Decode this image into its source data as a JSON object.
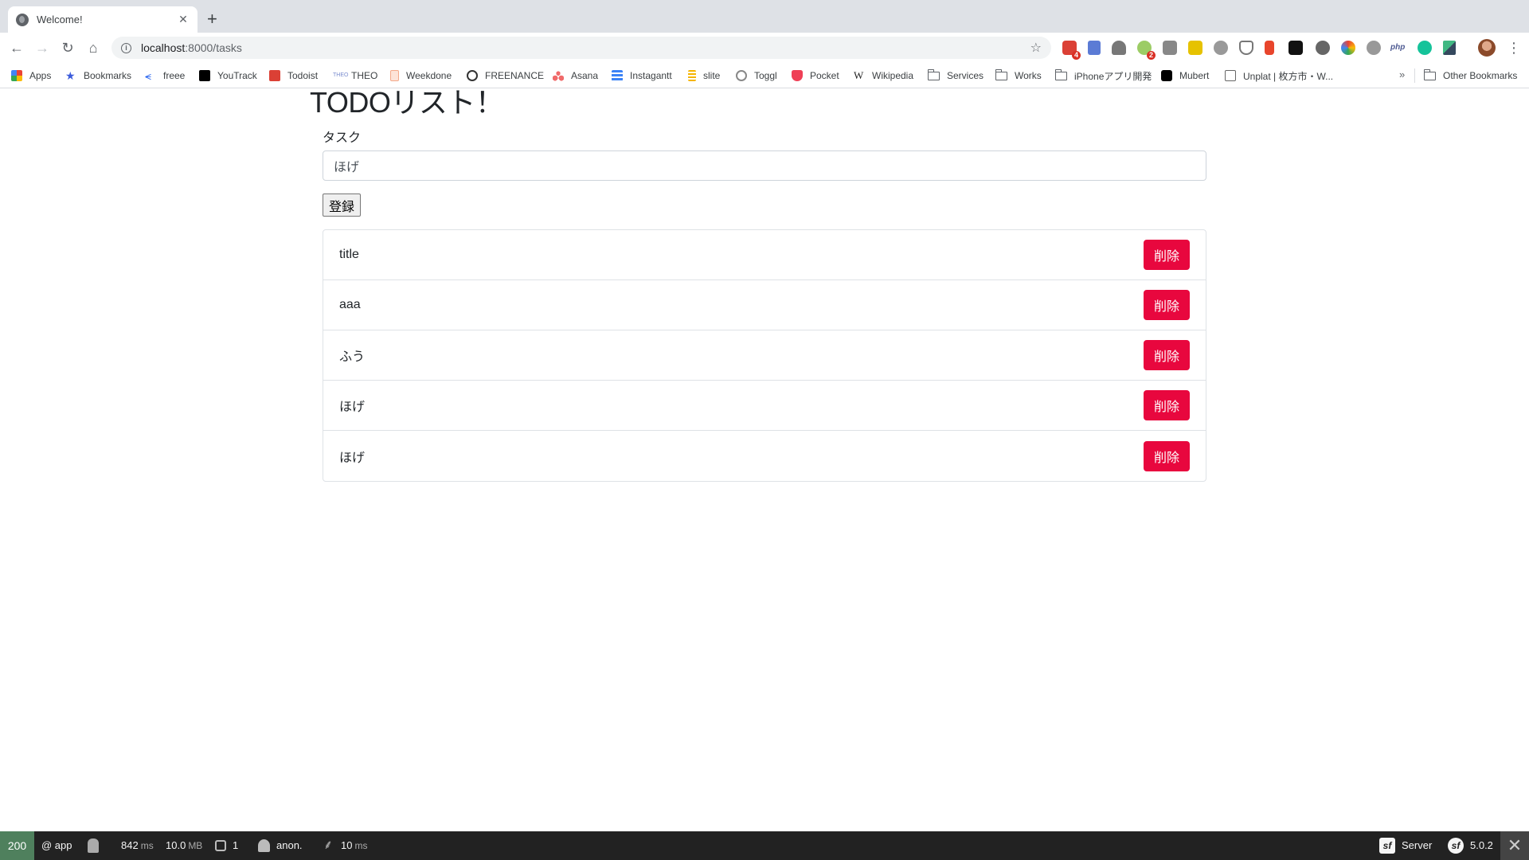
{
  "browser": {
    "tab_title": "Welcome!",
    "url_host": "localhost",
    "url_path": ":8000/tasks",
    "extension_badges": {
      "todoist": "4",
      "bulb": "2"
    }
  },
  "bookmarks": [
    {
      "label": "Apps",
      "icon": "apps-grid-icon",
      "color": "#4285f4"
    },
    {
      "label": "Bookmarks",
      "icon": "star-icon",
      "color": "#3b5bdb"
    },
    {
      "label": "freee",
      "icon": "freee-icon",
      "color": "#2864f0"
    },
    {
      "label": "YouTrack",
      "icon": "youtrack-icon",
      "color": "#000000"
    },
    {
      "label": "Todoist",
      "icon": "todoist-icon",
      "color": "#db4035"
    },
    {
      "label": "THEO",
      "icon": "theo-icon",
      "color": "#7a8ccf"
    },
    {
      "label": "Weekdone",
      "icon": "weekdone-icon",
      "color": "#f4a98a"
    },
    {
      "label": "FREENANCE",
      "icon": "freenance-icon",
      "color": "#333333"
    },
    {
      "label": "Asana",
      "icon": "asana-icon",
      "color": "#f06a6a"
    },
    {
      "label": "Instagantt",
      "icon": "instagantt-icon",
      "color": "#3b82f6"
    },
    {
      "label": "slite",
      "icon": "slite-icon",
      "color": "#f5b400"
    },
    {
      "label": "Toggl",
      "icon": "toggl-icon",
      "color": "#888888"
    },
    {
      "label": "Pocket",
      "icon": "pocket-icon",
      "color": "#ef3f56"
    },
    {
      "label": "Wikipedia",
      "icon": "wikipedia-icon",
      "color": "#222222"
    },
    {
      "label": "Services",
      "icon": "folder-icon",
      "color": "#5f6368"
    },
    {
      "label": "Works",
      "icon": "folder-icon",
      "color": "#5f6368"
    },
    {
      "label": "iPhoneアプリ開発",
      "icon": "folder-icon",
      "color": "#5f6368"
    },
    {
      "label": "Mubert",
      "icon": "mubert-icon",
      "color": "#000000"
    },
    {
      "label": "Unplat | 枚方市・W...",
      "icon": "unplat-icon",
      "color": "#666666"
    }
  ],
  "bookmarks_more": "»",
  "other_bookmarks": "Other Bookmarks",
  "page": {
    "title": "TODOリスト！",
    "task_label": "タスク",
    "task_input_value": "ほげ",
    "submit_label": "登録",
    "delete_label": "削除",
    "tasks": [
      "title",
      "aaa",
      "ふう",
      "ほげ",
      "ほげ"
    ]
  },
  "debugbar": {
    "status_code": "200",
    "route": "@ app",
    "time_value": "842",
    "time_unit": "ms",
    "memory_value": "10.0",
    "memory_unit": "MB",
    "requests_count": "1",
    "user": "anon.",
    "twig_value": "10",
    "twig_unit": "ms",
    "server_label": "Server",
    "symfony_version": "5.0.2"
  },
  "colors": {
    "delete_button": "#e8073e",
    "debug_status_ok": "#4f805d",
    "debugbar_bg": "#222222"
  }
}
